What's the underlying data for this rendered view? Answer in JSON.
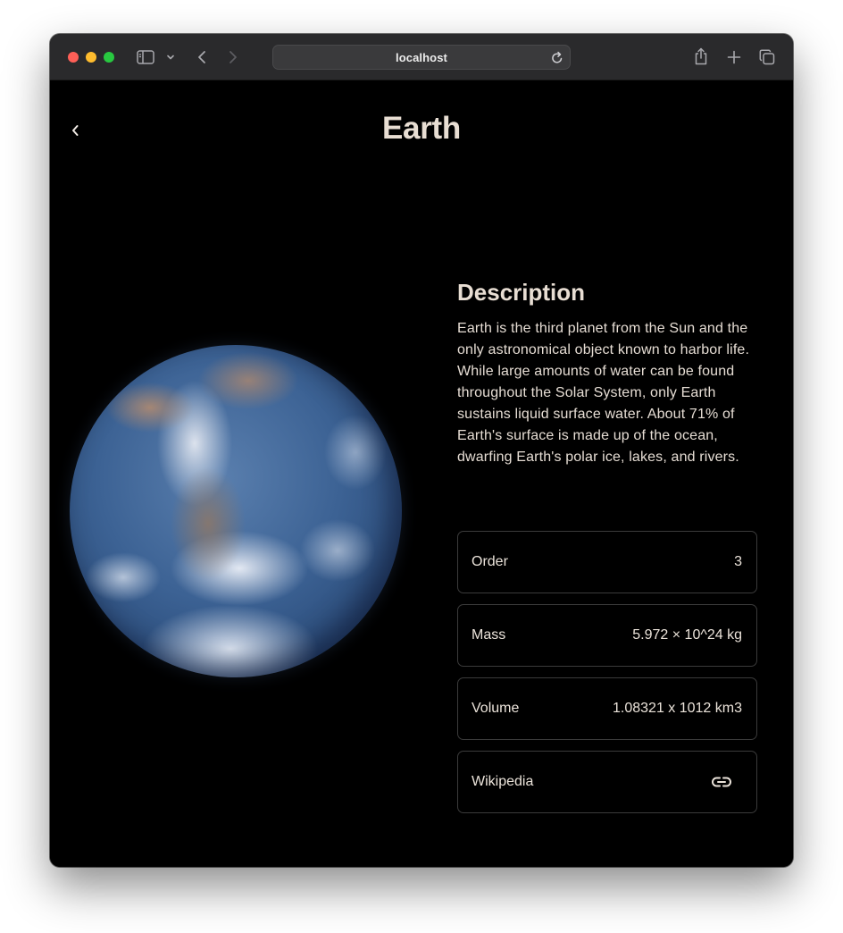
{
  "browser": {
    "address": "localhost"
  },
  "page": {
    "title": "Earth",
    "planet_image_alt": "Earth"
  },
  "description": {
    "heading": "Description",
    "text": "Earth is the third planet from the Sun and the only astronomical object known to harbor life. While large amounts of water can be found throughout the Solar System, only Earth sustains liquid surface water. About 71% of Earth's surface is made up of the ocean, dwarfing Earth's polar ice, lakes, and rivers."
  },
  "info": {
    "order": {
      "label": "Order",
      "value": "3"
    },
    "mass": {
      "label": "Mass",
      "value": "5.972 × 10^24 kg"
    },
    "volume": {
      "label": "Volume",
      "value": "1.08321 x 1012 km3"
    },
    "wikipedia": {
      "label": "Wikipedia",
      "icon": "link-icon"
    }
  },
  "colors": {
    "background": "#000000",
    "heading": "#e8ded3",
    "card_border": "#3b3b3b",
    "titlebar": "#2a2a2c"
  }
}
